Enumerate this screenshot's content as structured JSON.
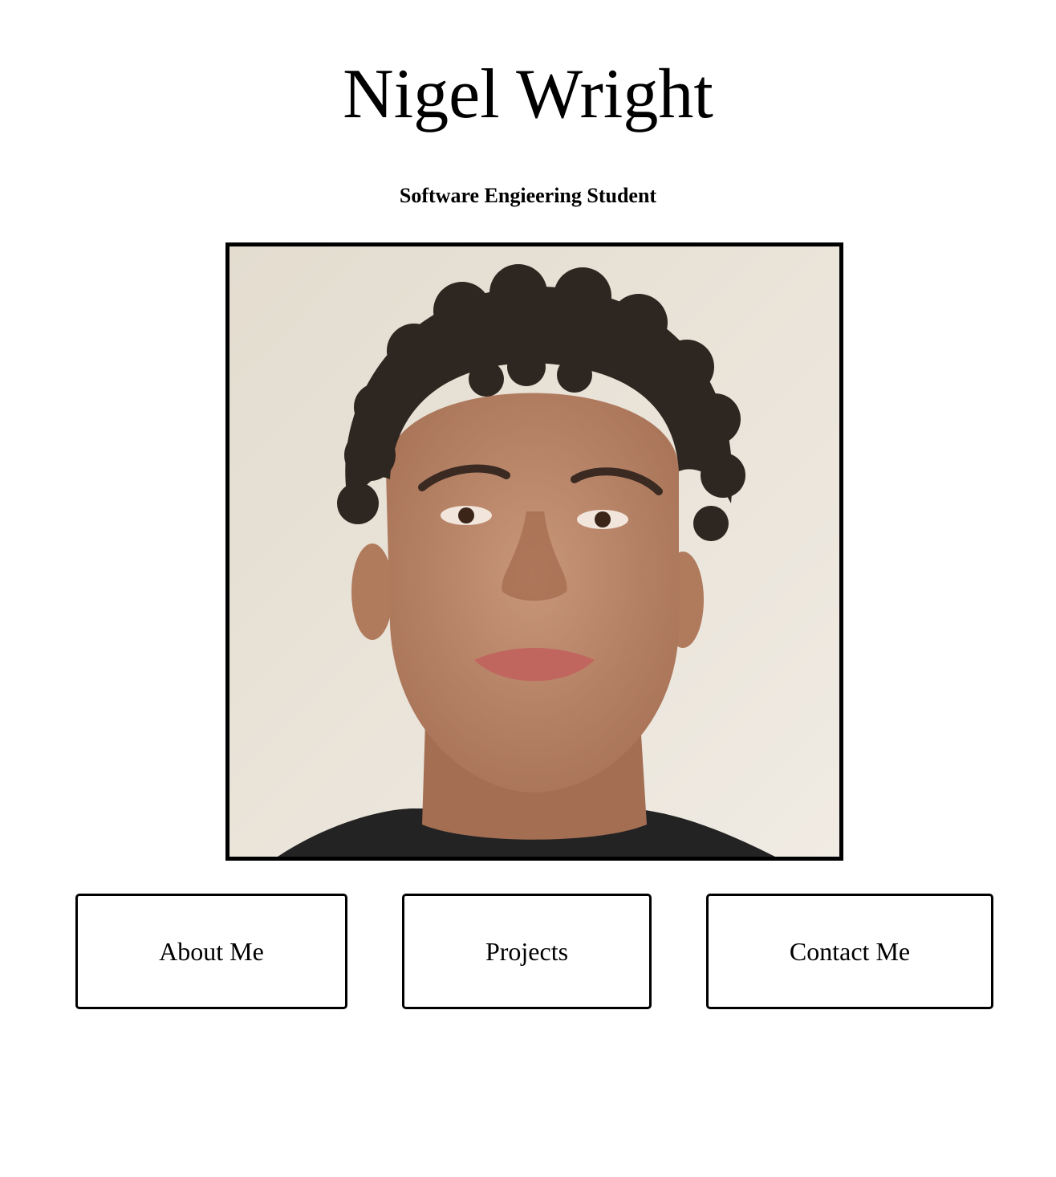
{
  "header": {
    "name": "Nigel Wright",
    "subtitle": "Software Engieering Student"
  },
  "portrait": {
    "alt": "Portrait photo",
    "background_color": "#e8e2d6",
    "skin_color": "#b98466",
    "hair_color": "#2e2620",
    "shirt_color": "#232323"
  },
  "nav": {
    "about_label": "About Me",
    "projects_label": "Projects",
    "contact_label": "Contact Me"
  }
}
